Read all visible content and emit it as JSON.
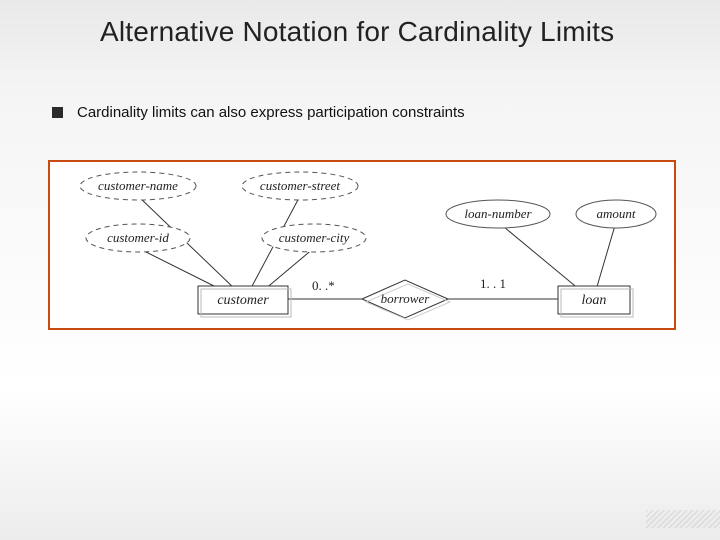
{
  "title": "Alternative Notation for Cardinality Limits",
  "bullet": "Cardinality limits can also express participation constraints",
  "diagram": {
    "attributes": {
      "customer_name": "customer-name",
      "customer_street": "customer-street",
      "customer_id": "customer-id",
      "customer_city": "customer-city",
      "loan_number": "loan-number",
      "amount": "amount"
    },
    "entities": {
      "customer": "customer",
      "loan": "loan"
    },
    "relationship": {
      "borrower": "borrower"
    },
    "cardinalities": {
      "left": "0. .*",
      "right": "1. . 1"
    }
  },
  "chart_data": {
    "type": "table",
    "description": "ER diagram showing entities, attributes, one relationship, and cardinality labels",
    "entities": [
      {
        "name": "customer",
        "attributes": [
          "customer-name",
          "customer-street",
          "customer-id",
          "customer-city"
        ]
      },
      {
        "name": "loan",
        "attributes": [
          "loan-number",
          "amount"
        ]
      }
    ],
    "relationships": [
      {
        "name": "borrower",
        "between": [
          "customer",
          "loan"
        ],
        "cardinality": {
          "customer_side": "0..*",
          "loan_side": "1..1"
        }
      }
    ]
  }
}
